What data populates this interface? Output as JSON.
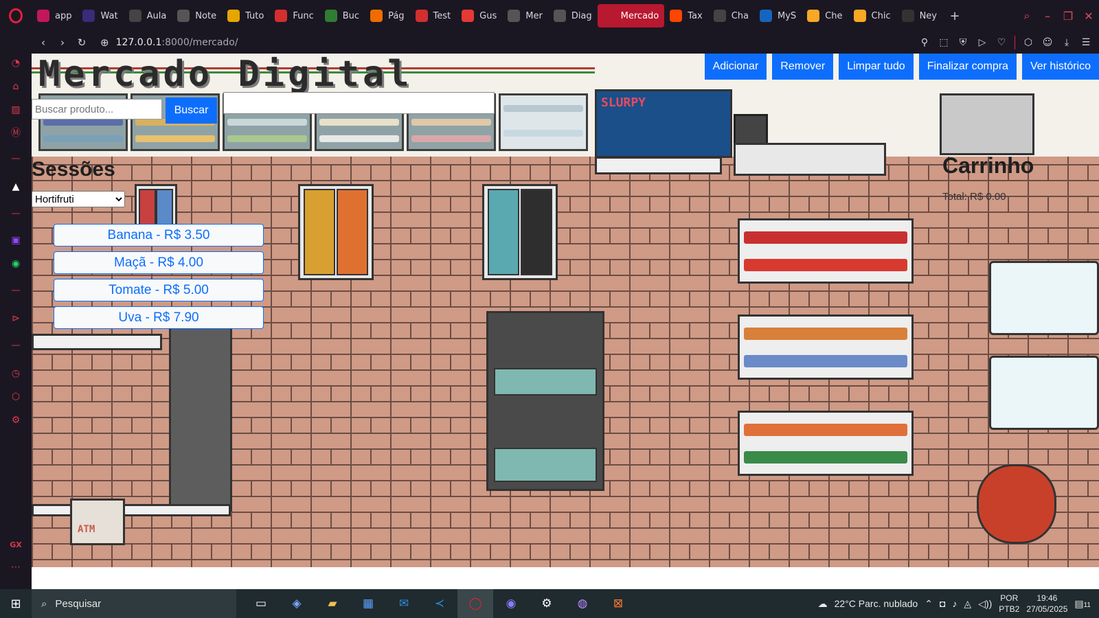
{
  "browser": {
    "tabs": [
      {
        "label": "app",
        "fav": "app-icon",
        "color": "#c2185b"
      },
      {
        "label": "Wat",
        "fav": "hi-icon",
        "color": "#3b2b7a"
      },
      {
        "label": "Aula",
        "fav": "play-icon",
        "color": "#444"
      },
      {
        "label": "Note",
        "fav": "doc-icon",
        "color": "#555"
      },
      {
        "label": "Tuto",
        "fav": "box-icon",
        "color": "#e6a600"
      },
      {
        "label": "Func",
        "fav": "slides-icon",
        "color": "#d32f2f"
      },
      {
        "label": "Buc",
        "fav": "sheet-icon",
        "color": "#2e7d32"
      },
      {
        "label": "Pág",
        "fav": "cube-icon",
        "color": "#ef6c00"
      },
      {
        "label": "Test",
        "fav": "slides-icon",
        "color": "#d32f2f"
      },
      {
        "label": "Gus",
        "fav": "youtube-icon",
        "color": "#e53935"
      },
      {
        "label": "Mer",
        "fav": "globe-icon",
        "color": "#555"
      },
      {
        "label": "Diag",
        "fav": "diagram-icon",
        "color": "#555"
      },
      {
        "label": "Mercado",
        "fav": "globe-icon",
        "color": "#b81830",
        "active": true
      },
      {
        "label": "Tax",
        "fav": "reddit-icon",
        "color": "#ff4500"
      },
      {
        "label": "Cha",
        "fav": "chatgpt-icon",
        "color": "#444"
      },
      {
        "label": "MyS",
        "fav": "mysql-icon",
        "color": "#1565c0"
      },
      {
        "label": "Che",
        "fav": "mcdonalds-icon",
        "color": "#f9a825"
      },
      {
        "label": "Chic",
        "fav": "mcdonalds-icon",
        "color": "#f9a825"
      },
      {
        "label": "Ney",
        "fav": "github-icon",
        "color": "#333"
      }
    ],
    "url_host": "127.0.0.1",
    "url_path": ":8000/mercado/"
  },
  "page": {
    "title": "Mercado Digital",
    "actions": {
      "add": "Adicionar",
      "remove": "Remover",
      "clear": "Limpar tudo",
      "checkout": "Finalizar compra",
      "history": "Ver histórico"
    },
    "search": {
      "placeholder": "Buscar produto...",
      "button": "Buscar",
      "value": ""
    },
    "sessions": {
      "title": "Sessões",
      "selected": "Hortifruti"
    },
    "products": [
      {
        "label": "Banana - R$ 3.50"
      },
      {
        "label": "Maçã - R$ 4.00"
      },
      {
        "label": "Tomate - R$ 5.00"
      },
      {
        "label": "Uva - R$ 7.90"
      }
    ],
    "cart": {
      "title": "Carrinho",
      "total": "Total: R$ 0.00"
    },
    "scene_labels": {
      "slurpy": "SLURPY",
      "atm": "ATM"
    }
  },
  "taskbar": {
    "search_label": "Pesquisar",
    "weather": "22°C  Parc. nublado",
    "lang_line1": "POR",
    "lang_line2": "PTB2",
    "time": "19:46",
    "date": "27/05/2025",
    "notification_count": "11"
  }
}
